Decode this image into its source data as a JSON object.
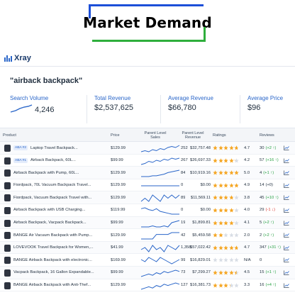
{
  "banner": {
    "title": "Market Demand"
  },
  "app": {
    "name": "Xray"
  },
  "query": "\"airback backpack\"",
  "metrics": [
    {
      "label": "Search Volume",
      "value": "4,246"
    },
    {
      "label": "Total Revenue",
      "value": "$2,537,625"
    },
    {
      "label": "Average Revenue",
      "value": "$66,780"
    },
    {
      "label": "Average Price",
      "value": "$96"
    }
  ],
  "columns": {
    "product": "Product",
    "price": "Price",
    "parent_sales": "Parent Level Sales",
    "parent_revenue": "Parent Level Revenue",
    "ratings": "Ratings",
    "reviews": "Reviews"
  },
  "colors": {
    "accent": "#2a66c9",
    "star": "#f5a623",
    "star_empty": "#d8dde5",
    "up": "#27a143",
    "down": "#d9342b"
  },
  "rows": [
    {
      "badge": "ABA #2",
      "name": "Laptop Travel Backpack...",
      "price": "$129.99",
      "sales": "252",
      "revenue": "$32,757.48",
      "stars": 4.7,
      "rating": "4.7",
      "reviews": "30",
      "delta": "(+2 ↑)",
      "dir": "up",
      "trend": [
        3,
        4,
        3,
        5,
        4,
        6,
        5,
        7,
        8,
        7,
        9
      ]
    },
    {
      "badge": "ABA #1",
      "name": "Airback Backpack, 60L...",
      "price": "$99.99",
      "sales": "267",
      "revenue": "$26,697.33",
      "stars": 4.2,
      "rating": "4.2",
      "reviews": "57",
      "delta": "(+16 ↑)",
      "dir": "up",
      "trend": [
        2,
        3,
        5,
        4,
        6,
        5,
        7,
        6,
        8,
        7,
        8
      ]
    },
    {
      "badge": "",
      "name": "Airback Backpack with Pump, 60L...",
      "price": "$129.99",
      "sales": "84",
      "revenue": "$10,919.16",
      "stars": 5.0,
      "rating": "5.0",
      "reviews": "4",
      "delta": "(+1 ↑)",
      "dir": "up",
      "trend": [
        1,
        1,
        1,
        2,
        2,
        3,
        4,
        6,
        7,
        8,
        9
      ]
    },
    {
      "badge": "",
      "name": "Fiordpack, 70L Vacuum Backpack Travel...",
      "price": "$129.99",
      "sales": "0",
      "revenue": "$0.00",
      "stars": 4.9,
      "rating": "4.9",
      "reviews": "14",
      "delta": "(+0)",
      "dir": "",
      "trend": [
        5,
        5,
        5,
        5,
        5,
        5,
        5,
        5,
        5,
        5,
        5
      ]
    },
    {
      "badge": "",
      "name": "Fiordpack, Vacuum Backpack Travel with...",
      "price": "$129.99",
      "sales": "89",
      "revenue": "$11,569.11",
      "stars": 3.8,
      "rating": "3.8",
      "reviews": "45",
      "delta": "(+10 ↑)",
      "dir": "up",
      "trend": [
        4,
        5,
        4,
        6,
        5,
        4,
        6,
        5,
        6,
        5,
        6
      ]
    },
    {
      "badge": "",
      "name": "Airback Backpack with USB Charging...",
      "price": "$119.99",
      "sales": "0",
      "revenue": "$0.00",
      "stars": 4.0,
      "rating": "4.0",
      "reviews": "29",
      "delta": "(-1 ↓)",
      "dir": "down",
      "trend": [
        7,
        8,
        6,
        5,
        7,
        4,
        3,
        2,
        1,
        1,
        1
      ]
    },
    {
      "badge": "",
      "name": "Airback Backpack, Vacpack Backpack...",
      "price": "$99.99",
      "sales": "19",
      "revenue": "$1,899.81",
      "stars": 4.1,
      "rating": "4.1",
      "reviews": "5",
      "delta": "(+2 ↑)",
      "dir": "up",
      "trend": [
        1,
        1,
        1,
        2,
        1,
        1,
        2,
        1,
        5,
        6,
        7
      ]
    },
    {
      "badge": "",
      "name": "BANGE Air Vacuum Backpack with Pump...",
      "price": "$129.99",
      "sales": "42",
      "revenue": "$5,459.58",
      "stars": 2.0,
      "rating": "2.0",
      "reviews": "2",
      "delta": "(+2 ↑)",
      "dir": "up",
      "trend": [
        1,
        1,
        1,
        1,
        6,
        6,
        6,
        6,
        8,
        8,
        8
      ]
    },
    {
      "badge": "",
      "name": "LOVEVOOK Travel Backpack for Women,...",
      "price": "$41.99",
      "sales": "1,358",
      "revenue": "$57,022.42",
      "stars": 4.7,
      "rating": "4.7",
      "reviews": "347",
      "delta": "(+31 ↑)",
      "dir": "up",
      "trend": [
        5,
        6,
        4,
        7,
        5,
        6,
        4,
        7,
        6,
        5,
        7
      ]
    },
    {
      "badge": "",
      "name": "BANGE Airback Backpack with electronic...",
      "price": "$169.99",
      "sales": "99",
      "revenue": "$16,829.01",
      "stars": 0,
      "rating": "N/A",
      "reviews": "0",
      "delta": "",
      "dir": "",
      "trend": [
        6,
        5,
        7,
        6,
        5,
        7,
        6,
        5,
        4,
        5,
        6
      ]
    },
    {
      "badge": "",
      "name": "Vacpack Backpack, 16 Gallon Expandable...",
      "price": "$99.99",
      "sales": "73",
      "revenue": "$7,299.27",
      "stars": 4.5,
      "rating": "4.5",
      "reviews": "15",
      "delta": "(+1 ↑)",
      "dir": "up",
      "trend": [
        3,
        4,
        5,
        4,
        6,
        5,
        7,
        6,
        7,
        8,
        7
      ]
    },
    {
      "badge": "",
      "name": "BANGE Airback Backpack with Anti-Thef...",
      "price": "$129.99",
      "sales": "127",
      "revenue": "$16,381.73",
      "stars": 3.3,
      "rating": "3.3",
      "reviews": "16",
      "delta": "(+4 ↑)",
      "dir": "up",
      "trend": [
        4,
        5,
        6,
        5,
        7,
        6,
        8,
        7,
        8,
        9,
        8
      ]
    }
  ]
}
